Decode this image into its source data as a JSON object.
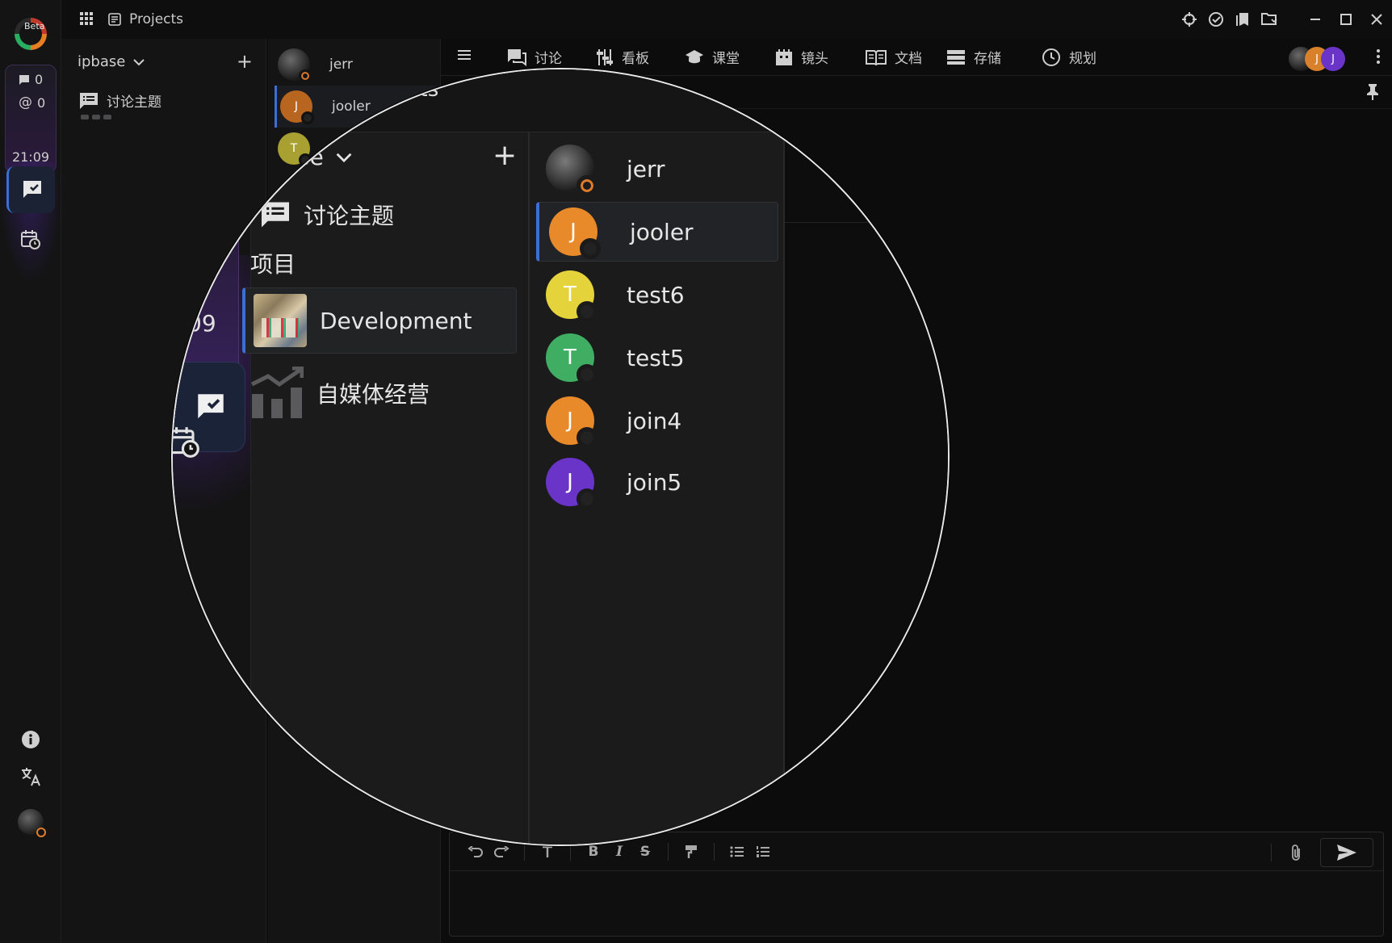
{
  "app": {
    "beta_label": "Beta",
    "title": "Projects"
  },
  "rail": {
    "message_count": "0",
    "mention_count": "0",
    "time": "21:09",
    "colors": {
      "accent": "#3b6fd6",
      "counter_bg": "#2b1a3d"
    }
  },
  "sidebar": {
    "workspace": "ipbase",
    "topic_label": "讨论主题"
  },
  "members": [
    {
      "name": "jerr",
      "initial": "",
      "color": "#3a3a3a",
      "status": "away"
    },
    {
      "name": "jooler",
      "initial": "J",
      "color": "#e8892a",
      "status": "offline",
      "active": true
    },
    {
      "name": "test6",
      "initial": "T",
      "color": "#e4d33a",
      "status": "offline"
    },
    {
      "name": "test5",
      "initial": "T",
      "color": "#3fae62",
      "status": "offline"
    },
    {
      "name": "join4",
      "initial": "J",
      "color": "#e8892a",
      "status": "offline"
    },
    {
      "name": "join5",
      "initial": "J",
      "color": "#6a34c9",
      "status": "offline"
    }
  ],
  "tabs": [
    {
      "label": "讨论",
      "icon": "chat-icon"
    },
    {
      "label": "看板",
      "icon": "kanban-icon"
    },
    {
      "label": "课堂",
      "icon": "classroom-icon"
    },
    {
      "label": "镜头",
      "icon": "camera-icon"
    },
    {
      "label": "文档",
      "icon": "book-icon"
    },
    {
      "label": "存储",
      "icon": "storage-icon"
    },
    {
      "label": "规划",
      "icon": "clock-icon"
    }
  ],
  "tab_avatar_initials": [
    "J",
    "J"
  ],
  "editor": {
    "tools": [
      "undo-icon",
      "redo-icon",
      "text-size-icon",
      "bold-icon",
      "italic-icon",
      "strikethrough-icon",
      "format-painter-icon",
      "bullet-list-icon",
      "numbered-list-icon"
    ],
    "bold": "B",
    "italic": "I",
    "strike": "S"
  },
  "magnifier": {
    "crumb": "jects",
    "workspace_partial": "base",
    "time_partial": "09",
    "topic_label": "讨论主题",
    "section_label": "项目",
    "projects": [
      {
        "name": "Development",
        "active": true,
        "icon": "project-thumbnail"
      },
      {
        "name": "自媒体经营",
        "active": false,
        "icon": "bar-chart-icon"
      }
    ]
  }
}
